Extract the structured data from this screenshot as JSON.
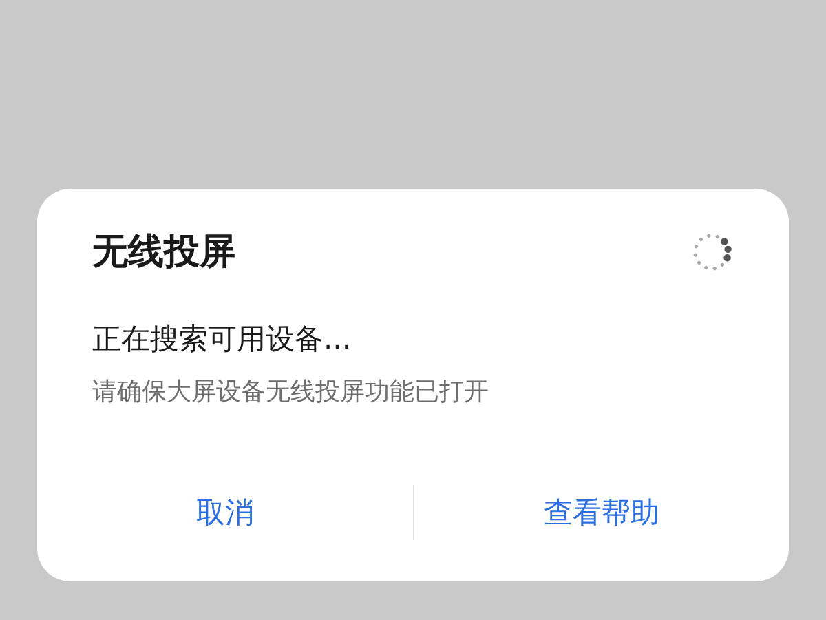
{
  "dialog": {
    "title": "无线投屏",
    "status": "正在搜索可用设备...",
    "hint": "请确保大屏设备无线投屏功能已打开",
    "loading": true,
    "buttons": [
      "取消",
      "查看帮助"
    ]
  }
}
